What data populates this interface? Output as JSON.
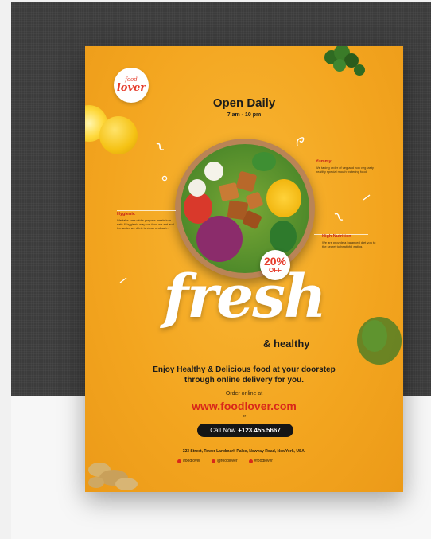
{
  "logo": {
    "line1": "food",
    "line2": "lover"
  },
  "header": {
    "title": "Open Daily",
    "hours": "7 am - 10 pm"
  },
  "badge": {
    "percent": "20%",
    "off": "OFF"
  },
  "callouts": {
    "yummy": {
      "title": "Yummy!",
      "text": "We taking order of veg and non veg tasty healthy special mouth watering food."
    },
    "hygienic": {
      "title": "Hygienic",
      "text": "We take care while prepare meals in a safe & hygienic way our food we eat and the water we drink is clean and safe."
    },
    "nutrition": {
      "title": "High Nutrition",
      "text": "We are provide a balanced diet you to the secret to healthful eating."
    }
  },
  "headline": {
    "fresh": "fresh",
    "healthy": "& healthy"
  },
  "tagline": {
    "line1": "Enjoy Healthy & Delicious food at your doorstep",
    "line2": "through online delivery for you."
  },
  "order": {
    "label": "Order online at",
    "url": "www.foodlover.com",
    "or": "or"
  },
  "call": {
    "label": "Call Now",
    "number": "+123.455.5667"
  },
  "address": "323 Street, Tower Landmark Palce, Newvay Road, NewYork, USA.",
  "social": [
    {
      "icon": "facebook-icon",
      "handle": "/foodlover"
    },
    {
      "icon": "twitter-icon",
      "handle": "@foodlover"
    },
    {
      "icon": "instagram-icon",
      "handle": "#foodlover"
    }
  ],
  "colors": {
    "flyer": "#f3a51f",
    "accent": "#d9281a",
    "dark": "#151515"
  }
}
